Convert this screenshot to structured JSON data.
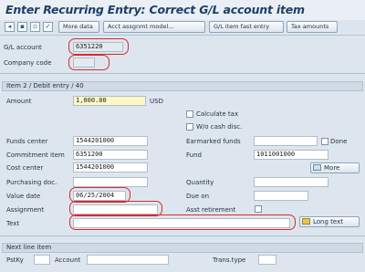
{
  "window": {
    "title": "Enter Recurring Entry: Correct G/L account item"
  },
  "toolbar": {
    "icons": [
      "prev-icon",
      "save-icon",
      "doc-icon",
      "choose-icon"
    ],
    "more_data": "More data",
    "acct_model": "Acct assgnmt model...",
    "gl_fast_entry": "G/L item fast entry",
    "tax_amounts": "Tax amounts"
  },
  "header": {
    "gl_account_label": "G/L account",
    "gl_account_value": "6351220",
    "company_code_label": "Company code",
    "company_code_value": ""
  },
  "item": {
    "section_title": "Item 2 / Debit entry / 40",
    "amount_label": "Amount",
    "amount_value": "1,000.00",
    "currency": "USD",
    "calculate_tax": "Calculate tax",
    "wo_cash_disc": "W/o cash disc.",
    "funds_center_label": "Funds center",
    "funds_center_value": "1544201000",
    "earmarked_funds_label": "Earmarked funds",
    "earmarked_funds_value": "",
    "done_label": "Done",
    "commitment_item_label": "Commitment item",
    "commitment_item_value": "6351200",
    "fund_label": "Fund",
    "fund_value": "1011001000",
    "cost_center_label": "Cost center",
    "cost_center_value": "1544201000",
    "more_button": "More",
    "purchasing_doc_label": "Purchasing doc.",
    "purchasing_doc_value": "",
    "quantity_label": "Quantity",
    "quantity_value": "",
    "value_date_label": "Value date",
    "value_date_value": "06/25/2004",
    "due_on_label": "Due on",
    "due_on_value": "",
    "assignment_label": "Assignment",
    "assignment_value": "",
    "asst_retirement_label": "Asst retirement",
    "text_label": "Text",
    "text_value": "",
    "long_text_button": "Long text"
  },
  "next_line": {
    "section_title": "Next line item",
    "pstky_label": "PstKy",
    "account_label": "Account",
    "trans_type_label": "Trans.type"
  },
  "colors": {
    "highlight_ring": "#d62c2c",
    "title_text": "#1d3f66",
    "background": "#dde6ee"
  }
}
